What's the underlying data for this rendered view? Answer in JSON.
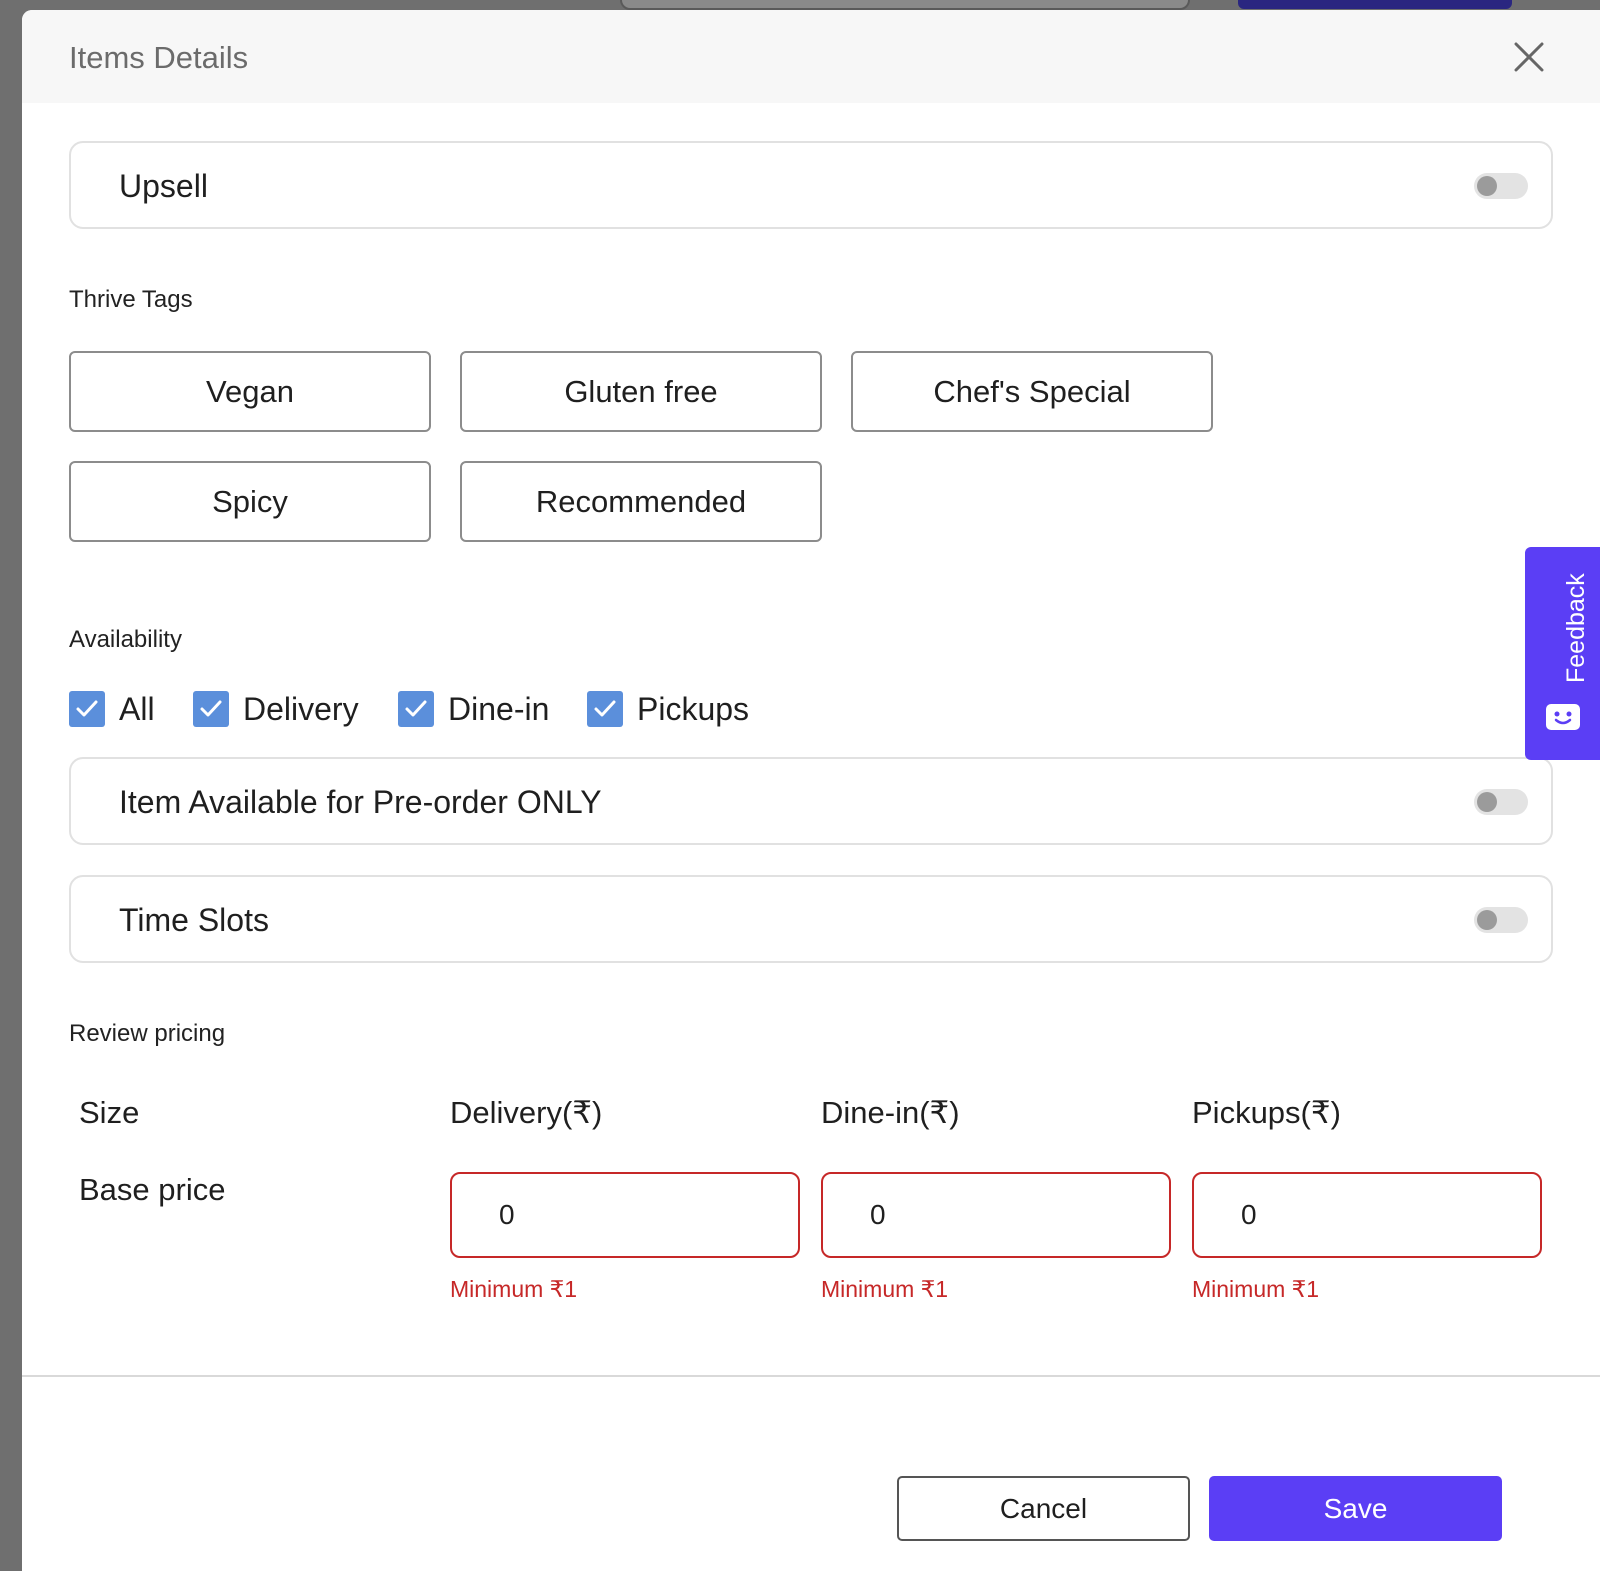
{
  "modal": {
    "title": "Items Details"
  },
  "upsell": {
    "label": "Upsell",
    "enabled": false
  },
  "thrive_tags": {
    "heading": "Thrive Tags",
    "tags": [
      "Vegan",
      "Gluten free",
      "Chef's Special",
      "Spicy",
      "Recommended"
    ]
  },
  "availability": {
    "heading": "Availability",
    "options": [
      {
        "label": "All",
        "checked": true
      },
      {
        "label": "Delivery",
        "checked": true
      },
      {
        "label": "Dine-in",
        "checked": true
      },
      {
        "label": "Pickups",
        "checked": true
      }
    ]
  },
  "preorder": {
    "label": "Item Available for Pre-order ONLY",
    "enabled": false
  },
  "time_slots": {
    "label": "Time Slots",
    "enabled": false
  },
  "pricing": {
    "heading": "Review pricing",
    "size_header": "Size",
    "row_label": "Base price",
    "columns": [
      {
        "header": "Delivery(₹)",
        "value": "0",
        "error": "Minimum ₹1"
      },
      {
        "header": "Dine-in(₹)",
        "value": "0",
        "error": "Minimum ₹1"
      },
      {
        "header": "Pickups(₹)",
        "value": "0",
        "error": "Minimum ₹1"
      }
    ]
  },
  "footer": {
    "cancel_label": "Cancel",
    "save_label": "Save"
  },
  "feedback": {
    "label": "Feedback"
  },
  "colors": {
    "accent": "#5b3ef5",
    "checkbox": "#5b8fdb",
    "error": "#c62828"
  }
}
